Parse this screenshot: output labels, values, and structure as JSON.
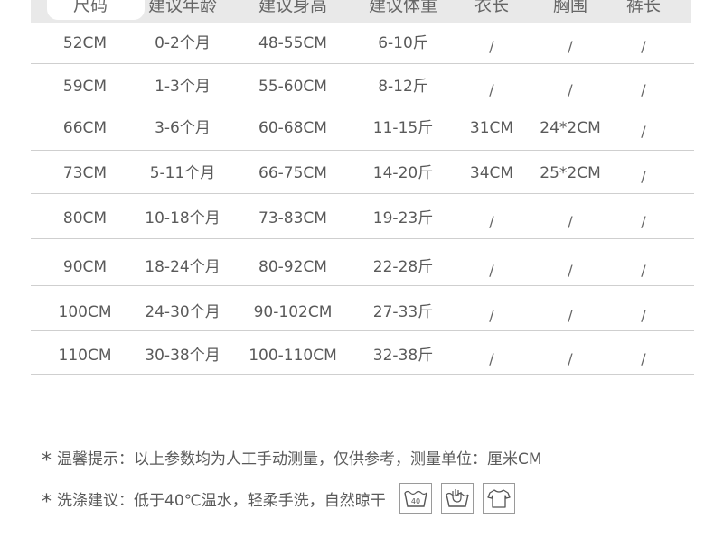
{
  "table": {
    "headers": [
      "尺码",
      "建议年龄",
      "建议身高",
      "建议体重",
      "衣长",
      "胸围",
      "裤长"
    ],
    "rows": [
      [
        "52CM",
        "0-2个月",
        "48-55CM",
        "6-10斤",
        "/",
        "/",
        "/"
      ],
      [
        "59CM",
        "1-3个月",
        "55-60CM",
        "8-12斤",
        "/",
        "/",
        "/"
      ],
      [
        "66CM",
        "3-6个月",
        "60-68CM",
        "11-15斤",
        "31CM",
        "24*2CM",
        "/"
      ],
      [
        "73CM",
        "5-11个月",
        "66-75CM",
        "14-20斤",
        "34CM",
        "25*2CM",
        "/"
      ],
      [
        "80CM",
        "10-18个月",
        "73-83CM",
        "19-23斤",
        "/",
        "/",
        "/"
      ],
      [
        "90CM",
        "18-24个月",
        "80-92CM",
        "22-28斤",
        "/",
        "/",
        "/"
      ],
      [
        "100CM",
        "24-30个月",
        "90-102CM",
        "27-33斤",
        "/",
        "/",
        "/"
      ],
      [
        "110CM",
        "30-38个月",
        "100-110CM",
        "32-38斤",
        "/",
        "/",
        "/"
      ]
    ]
  },
  "notes": {
    "star": "*",
    "tip": "温馨提示：以上参数均为人工手动测量，仅供参考，测量单位：厘米CM",
    "wash": "洗涤建议：低于40℃温水，轻柔手洗，自然晾干"
  },
  "care_icons": {
    "wash_temp_label": "40",
    "icons": [
      "wash-40-icon",
      "hand-wash-icon",
      "hang-dry-icon"
    ]
  }
}
